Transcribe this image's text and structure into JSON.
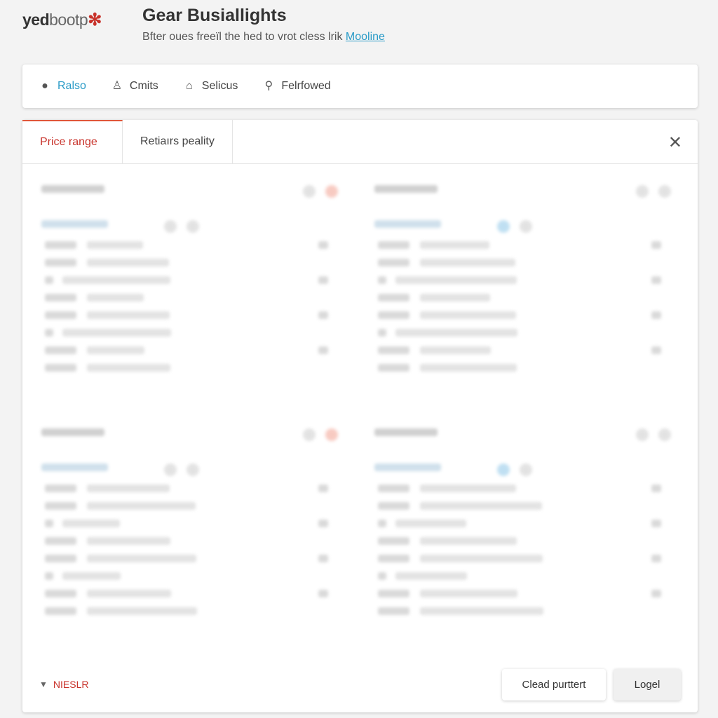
{
  "header": {
    "logo": {
      "dark": "yed",
      "light": "bootp",
      "burst": "✻"
    },
    "title": "Gear Busiallights",
    "subtitle": "Bfter oues freeïl the hed to vrot cless lrik",
    "subtitle_link": "Mooline"
  },
  "nav": {
    "items": [
      {
        "label": "Ralso",
        "icon": "map-pin-icon",
        "active": true
      },
      {
        "label": "Cmits",
        "icon": "person-icon",
        "active": false
      },
      {
        "label": "Selicus",
        "icon": "home-icon",
        "active": false
      },
      {
        "label": "Felrfowed",
        "icon": "search-icon",
        "active": false
      }
    ]
  },
  "panel": {
    "tabs": [
      {
        "label": "Price range",
        "active": true
      },
      {
        "label": "Retiaırs peality",
        "active": false
      }
    ],
    "close_icon": "close-icon",
    "footer": {
      "toggle_label": "NIESLR",
      "primary_button": "Clead purttert",
      "secondary_button": "Logel"
    }
  },
  "colors": {
    "accent_blue": "#2a9bc7",
    "accent_red": "#c8322a"
  }
}
